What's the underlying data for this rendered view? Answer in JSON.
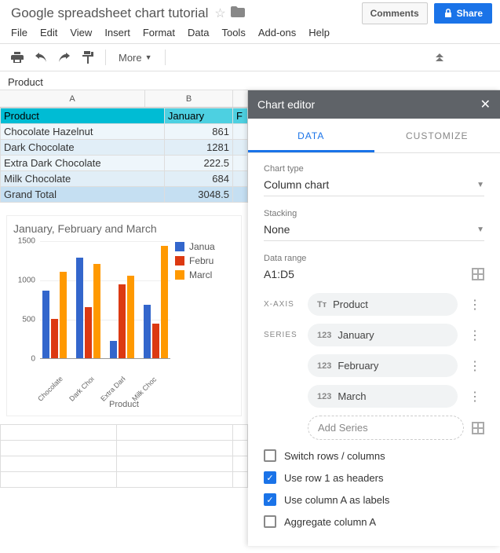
{
  "doc_title": "Google spreadsheet chart tutorial",
  "buttons": {
    "comments": "Comments",
    "share": "Share"
  },
  "menubar": [
    "File",
    "Edit",
    "View",
    "Insert",
    "Format",
    "Data",
    "Tools",
    "Add-ons",
    "Help"
  ],
  "toolbar": {
    "more": "More"
  },
  "name_box": "Product",
  "columns": [
    "A",
    "B"
  ],
  "col_c_partial": "F",
  "sheet": {
    "header": [
      "Product",
      "January"
    ],
    "rows": [
      {
        "product": "Chocolate Hazelnut",
        "january": 861
      },
      {
        "product": "Dark Chocolate",
        "january": 1281
      },
      {
        "product": "Extra Dark Chocolate",
        "january": 222.5
      },
      {
        "product": "Milk Chocolate",
        "january": 684
      }
    ],
    "total": {
      "label": "Grand Total",
      "january": 3048.5
    }
  },
  "chart_data": {
    "type": "bar",
    "title": "January, February and March",
    "xlabel": "Product",
    "ylabel": "",
    "ylim": [
      0,
      1500
    ],
    "yticks": [
      0,
      500,
      1000,
      1500
    ],
    "categories": [
      "Chocolate Hazelnut",
      "Dark Chocolate",
      "Extra Dark Chocolate",
      "Milk Chocolate"
    ],
    "category_labels_short": [
      "Chocolate...",
      "Dark Choc...",
      "Extra Dark...",
      "Milk Choc..."
    ],
    "series": [
      {
        "name": "January",
        "color": "#3366cc",
        "values": [
          861,
          1281,
          222.5,
          684
        ],
        "legend_short": "Janua"
      },
      {
        "name": "February",
        "color": "#dc3912",
        "values": [
          500,
          650,
          940,
          440
        ],
        "legend_short": "Febru"
      },
      {
        "name": "March",
        "color": "#ff9900",
        "values": [
          1100,
          1200,
          1050,
          1430
        ],
        "legend_short": "Marcl"
      }
    ]
  },
  "panel": {
    "title": "Chart editor",
    "tabs": {
      "data": "DATA",
      "customize": "CUSTOMIZE"
    },
    "chart_type": {
      "label": "Chart type",
      "value": "Column chart"
    },
    "stacking": {
      "label": "Stacking",
      "value": "None"
    },
    "data_range": {
      "label": "Data range",
      "value": "A1:D5"
    },
    "xaxis": {
      "label": "X-AXIS",
      "field": "Product"
    },
    "series": {
      "label": "SERIES",
      "items": [
        "January",
        "February",
        "March"
      ],
      "add": "Add Series"
    },
    "checks": {
      "switch": "Switch rows / columns",
      "headers": "Use row 1 as headers",
      "labels": "Use column A as labels",
      "aggregate": "Aggregate column A"
    },
    "checked": {
      "switch": false,
      "headers": true,
      "labels": true,
      "aggregate": false
    }
  }
}
